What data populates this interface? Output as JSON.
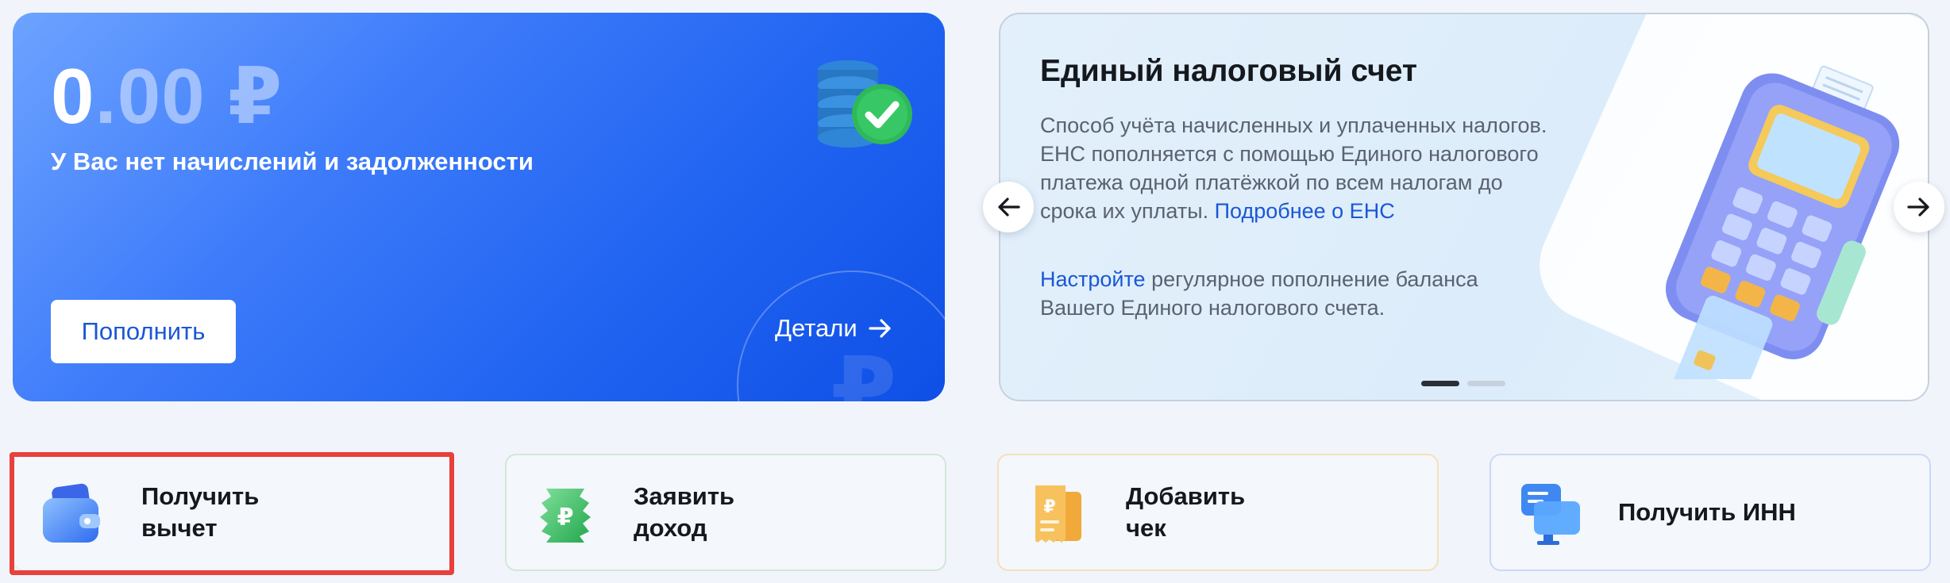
{
  "balance": {
    "amount_integer": "0",
    "amount_decimal": ".00",
    "currency": "₽",
    "status": "У Вас нет начислений и задолженности",
    "topup_label": "Пополнить",
    "details_label": "Детали",
    "accent_color": "#1f62f0"
  },
  "promo": {
    "title": "Единый налоговый счет",
    "description": "Способ учёта начисленных и уплаченных налогов. ЕНС пополняется с помощью Единого налогового платежа одной платёжкой по всем налогам до срока их уплаты.",
    "more_link": "Подробнее о ЕНС",
    "setup_link": "Настройте",
    "setup_text": "регулярное пополнение баланса Вашего Единого налогового счета.",
    "slide_count": 2,
    "active_slide": 1
  },
  "actions": [
    {
      "line1": "Получить",
      "line2": "вычет",
      "icon": "wallet-icon"
    },
    {
      "line1": "Заявить",
      "line2": "доход",
      "icon": "ruble-ticket-icon"
    },
    {
      "line1": "Добавить",
      "line2": "чек",
      "icon": "receipt-icon"
    },
    {
      "line1": "Получить ИНН",
      "line2": "",
      "icon": "monitor-chat-icon"
    }
  ],
  "highlight_color": "#e8403c"
}
